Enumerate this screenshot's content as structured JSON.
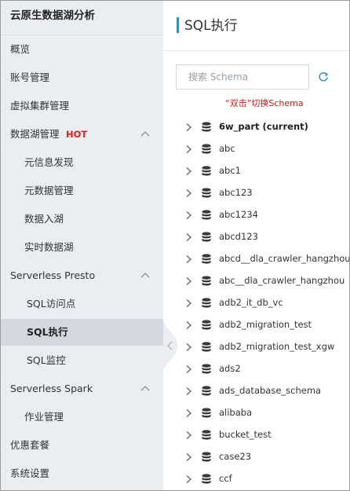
{
  "sidebar": {
    "title": "云原生数据湖分析",
    "items": [
      {
        "label": "概览"
      },
      {
        "label": "账号管理"
      },
      {
        "label": "虚拟集群管理"
      },
      {
        "label": "数据湖管理",
        "badge": "HOT"
      },
      {
        "label": "元信息发现"
      },
      {
        "label": "元数据管理"
      },
      {
        "label": "数据入湖"
      },
      {
        "label": "实时数据湖"
      },
      {
        "label": "Serverless Presto"
      },
      {
        "label": "SQL访问点"
      },
      {
        "label": "SQL执行",
        "active": true
      },
      {
        "label": "SQL监控"
      },
      {
        "label": "Serverless Spark"
      },
      {
        "label": "作业管理"
      },
      {
        "label": "优惠套餐"
      },
      {
        "label": "系统设置"
      }
    ]
  },
  "header": {
    "title": "SQL执行"
  },
  "search": {
    "placeholder": "搜索 Schema",
    "value": ""
  },
  "hint": "“双击”切换Schema",
  "schemas": [
    {
      "name": "6w_part (current)",
      "current": true
    },
    {
      "name": "abc"
    },
    {
      "name": "abc1"
    },
    {
      "name": "abc123"
    },
    {
      "name": "abc1234"
    },
    {
      "name": "abcd123"
    },
    {
      "name": "abcd__dla_crawler_hangzhou"
    },
    {
      "name": "abc__dla_crawler_hangzhou"
    },
    {
      "name": "adb2_it_db_vc"
    },
    {
      "name": "adb2_migration_test"
    },
    {
      "name": "adb2_migration_test_xgw"
    },
    {
      "name": "ads2"
    },
    {
      "name": "ads_database_schema"
    },
    {
      "name": "alibaba"
    },
    {
      "name": "bucket_test"
    },
    {
      "name": "case23"
    },
    {
      "name": "ccf"
    }
  ],
  "colors": {
    "accent": "#00a1e9",
    "hot": "#e0201b",
    "hint": "#c2201a",
    "sidebar_bg": "#eaedf1",
    "active_bg": "#d3d8de"
  },
  "icons": {
    "tree_expand": "chevron-right-icon",
    "database": "database-icon",
    "refresh": "refresh-icon",
    "collapse": "chevron-up-icon",
    "sidebar_toggle": "chevron-left-icon"
  }
}
